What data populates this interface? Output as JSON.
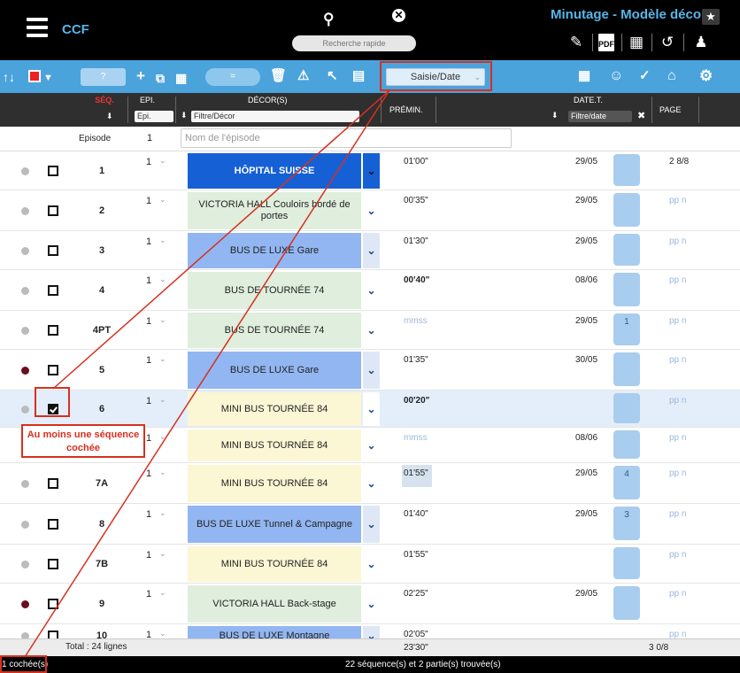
{
  "top": {
    "app_name": "CCF",
    "quick_search_placeholder": "Recherche rapide",
    "view_title": "Minutage - Modèle décor",
    "icons": [
      "search-icon",
      "clear-icon",
      "star-icon",
      "edit-icon",
      "pdf-icon",
      "calculator-icon",
      "share-icon",
      "user-settings-icon"
    ]
  },
  "toolbar": {
    "page_field": "?",
    "toggle_label": "=",
    "saisie_select": "Saisie/Date"
  },
  "header": {
    "seq": "SÉQ.",
    "epi": "EPI.",
    "epi_filter": "Epi.",
    "decors": "DÉCOR(S)",
    "decor_filter": "Filtre/Décor",
    "premin": "PRÉMIN.",
    "date": "DATE.T.",
    "date_filter": "Filtre/date",
    "page": "PAGE"
  },
  "episode": {
    "label": "Episode",
    "value": "1",
    "name_placeholder": "Nom de l'épisode"
  },
  "rows": [
    {
      "dot": "#bbbbbb",
      "checked": false,
      "seq": "1",
      "epi": "1",
      "decor": "HÔPITAL SUISSE",
      "decor_bg": "#1660d6",
      "decor_fg": "#ffffff",
      "dd_bg": "#1660d6",
      "dd_fg": "#111",
      "premin": "01'00\"",
      "premin_style": "normal",
      "date": "29/05",
      "badge": "",
      "page": "2 8/8",
      "page_style": "dark"
    },
    {
      "dot": "#bbbbbb",
      "checked": false,
      "seq": "2",
      "epi": "1",
      "decor": "VICTORIA HALL Couloirs bordé de portes",
      "decor_bg": "#dfeedd",
      "decor_fg": "#222",
      "dd_bg": "#ffffff",
      "dd_fg": "#1d4f8c",
      "premin": "00'35\"",
      "premin_style": "normal",
      "date": "29/05",
      "badge": "",
      "page": "pp n",
      "page_style": "light"
    },
    {
      "dot": "#bbbbbb",
      "checked": false,
      "seq": "3",
      "epi": "1",
      "decor": "BUS DE LUXE Gare",
      "decor_bg": "#92b6f1",
      "decor_fg": "#222",
      "dd_bg": "#dfe7f7",
      "dd_fg": "#1d4f8c",
      "premin": "01'30\"",
      "premin_style": "normal",
      "date": "29/05",
      "badge": "",
      "page": "pp n",
      "page_style": "light"
    },
    {
      "dot": "#bbbbbb",
      "checked": false,
      "seq": "4",
      "epi": "1",
      "decor": "BUS DE TOURNÉE 74",
      "decor_bg": "#dfeedd",
      "decor_fg": "#222",
      "dd_bg": "#ffffff",
      "dd_fg": "#1d4f8c",
      "premin": "00'40\"",
      "premin_style": "bold",
      "date": "08/06",
      "badge": "",
      "page": "pp n",
      "page_style": "light"
    },
    {
      "dot": "#bbbbbb",
      "checked": false,
      "seq": "4PT",
      "epi": "1",
      "decor": "BUS DE TOURNÉE 74",
      "decor_bg": "#dfeedd",
      "decor_fg": "#222",
      "dd_bg": "#ffffff",
      "dd_fg": "#1d4f8c",
      "premin": "mmss",
      "premin_style": "placeholder",
      "date": "29/05",
      "badge": "1",
      "page": "pp n",
      "page_style": "light"
    },
    {
      "dot": "#6b0f1f",
      "checked": false,
      "seq": "5",
      "epi": "1",
      "decor": "BUS DE LUXE Gare",
      "decor_bg": "#92b6f1",
      "decor_fg": "#222",
      "dd_bg": "#dfe7f7",
      "dd_fg": "#1d4f8c",
      "premin": "01'35\"",
      "premin_style": "normal",
      "date": "30/05",
      "badge": "",
      "page": "pp n",
      "page_style": "light"
    },
    {
      "dot": "#bbbbbb",
      "checked": true,
      "seq": "6",
      "epi": "1",
      "decor": "MINI BUS TOURNÉE 84",
      "decor_bg": "#fbf7d4",
      "decor_fg": "#222",
      "dd_bg": "#ffffff",
      "dd_fg": "#1d4f8c",
      "premin": "00'20\"",
      "premin_style": "bold",
      "date": "",
      "badge": "",
      "page": "pp n",
      "page_style": "light",
      "selected": true
    },
    {
      "dot": "#bbbbbb",
      "checked": false,
      "seq": "",
      "epi": "1",
      "decor": "MINI BUS TOURNÉE 84",
      "decor_bg": "#fbf7d4",
      "decor_fg": "#222",
      "dd_bg": "#ffffff",
      "dd_fg": "#1d4f8c",
      "premin": "mmss",
      "premin_style": "placeholder",
      "date": "08/06",
      "badge": "",
      "page": "pp n",
      "page_style": "light"
    },
    {
      "dot": "#bbbbbb",
      "checked": false,
      "seq": "7A",
      "epi": "1",
      "decor": "MINI BUS TOURNÉE 84",
      "decor_bg": "#fbf7d4",
      "decor_fg": "#222",
      "dd_bg": "#ffffff",
      "dd_fg": "#1d4f8c",
      "premin": "01'55\"",
      "premin_style": "boxed",
      "date": "29/05",
      "badge": "4",
      "page": "pp n",
      "page_style": "light"
    },
    {
      "dot": "#bbbbbb",
      "checked": false,
      "seq": "8",
      "epi": "1",
      "decor": "BUS DE LUXE Tunnel & Campagne",
      "decor_bg": "#92b6f1",
      "decor_fg": "#222",
      "dd_bg": "#dfe7f7",
      "dd_fg": "#1d4f8c",
      "premin": "01'40\"",
      "premin_style": "normal",
      "date": "29/05",
      "badge": "3",
      "page": "pp n",
      "page_style": "light"
    },
    {
      "dot": "#bbbbbb",
      "checked": false,
      "seq": "7B",
      "epi": "1",
      "decor": "MINI BUS TOURNÉE 84",
      "decor_bg": "#fbf7d4",
      "decor_fg": "#222",
      "dd_bg": "#ffffff",
      "dd_fg": "#1d4f8c",
      "premin": "01'55\"",
      "premin_style": "normal",
      "date": "",
      "badge": "",
      "page": "pp n",
      "page_style": "light"
    },
    {
      "dot": "#6b0f1f",
      "checked": false,
      "seq": "9",
      "epi": "1",
      "decor": "VICTORIA HALL Back-stage",
      "decor_bg": "#dfeedd",
      "decor_fg": "#222",
      "dd_bg": "#ffffff",
      "dd_fg": "#1d4f8c",
      "premin": "02'25\"",
      "premin_style": "normal",
      "date": "29/05",
      "badge": "",
      "page": "pp n",
      "page_style": "light"
    },
    {
      "dot": "#bbbbbb",
      "checked": false,
      "seq": "10",
      "epi": "1",
      "decor": "BUS DE LUXE Montagne",
      "decor_bg": "#92b6f1",
      "decor_fg": "#222",
      "dd_bg": "#dfe7f7",
      "dd_fg": "#1d4f8c",
      "premin": "02'05\"",
      "premin_style": "normal",
      "date": "",
      "badge": "",
      "page": "pp n",
      "page_style": "light"
    }
  ],
  "total": {
    "label": "Total : 24 lignes",
    "premin": "23'30\"",
    "page": "3 0/8"
  },
  "status": {
    "checked": "1 cochée(s)",
    "found": "22 séquence(s) et 2 partie(s) trouvée(s)"
  },
  "annotation": {
    "callout": "Au moins une séquence cochée"
  },
  "colors": {
    "topbar": "#000000",
    "brand": "#56b6e9",
    "toolbar": "#4ba3dc",
    "header": "#2f2f2f",
    "annotation": "#d6301f"
  }
}
